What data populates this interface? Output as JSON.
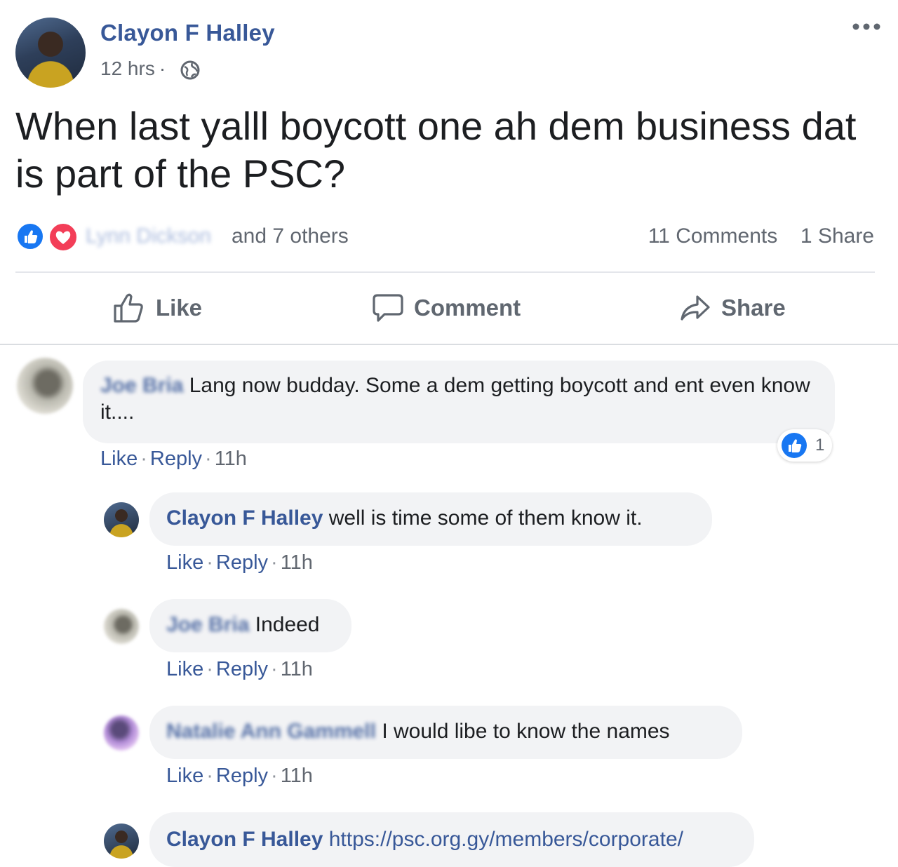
{
  "post": {
    "author": "Clayon F Halley",
    "time": "12 hrs",
    "visibility_icon": "globe-icon",
    "text": "When last yalll boycott one ah dem business dat is part of the PSC?",
    "reactions": {
      "icons": [
        "like-reaction-icon",
        "love-reaction-icon"
      ],
      "first_name": "Lynn Dickson",
      "rest": "and 7 others"
    },
    "comments_count": "11 Comments",
    "shares_count": "1 Share"
  },
  "actions": {
    "like": "Like",
    "comment": "Comment",
    "share": "Share"
  },
  "comments": [
    {
      "author": "Joe Bria",
      "text": "Lang now budday. Some a dem getting boycott and ent even know it....",
      "like": "Like",
      "reply": "Reply",
      "time": "11h",
      "reaction_count": "1"
    },
    {
      "author": "Clayon F Halley",
      "text": "well is time some of them know it.",
      "like": "Like",
      "reply": "Reply",
      "time": "11h"
    },
    {
      "author": "Joe Bria",
      "text": "Indeed",
      "like": "Like",
      "reply": "Reply",
      "time": "11h"
    },
    {
      "author": "Natalie Ann Gammell",
      "text": "I would libe to know the names",
      "like": "Like",
      "reply": "Reply",
      "time": "11h"
    },
    {
      "author": "Clayon F Halley",
      "text": "https://psc.org.gy/members/corporate/"
    }
  ],
  "colors": {
    "link_blue": "#385898",
    "bubble_bg": "#f2f3f5",
    "like_blue": "#1877f2",
    "love_red": "#f33e58"
  }
}
